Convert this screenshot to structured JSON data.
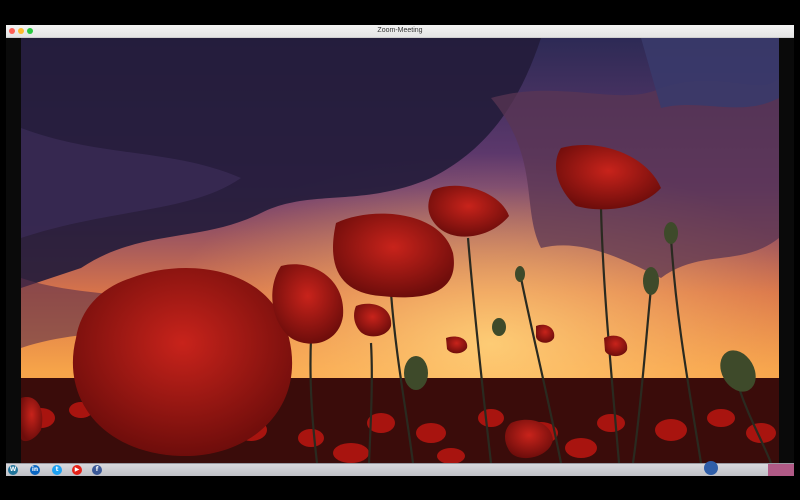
{
  "window": {
    "title": "Zoom-Meeting"
  },
  "video": {
    "description_icon": "shared-screen-video"
  },
  "taskbar": {
    "icons": [
      {
        "name": "wordpress-icon",
        "glyph": "W",
        "color": "#21759b"
      },
      {
        "name": "linkedin-icon",
        "glyph": "in",
        "color": "#0a66c2"
      },
      {
        "name": "twitter-icon",
        "glyph": "t",
        "color": "#1da1f2"
      },
      {
        "name": "youtube-icon",
        "glyph": "▶",
        "color": "#e62117"
      },
      {
        "name": "facebook-icon",
        "glyph": "f",
        "color": "#3b5998"
      }
    ],
    "accent_color": "#b05a86"
  },
  "colors": {
    "close": "#fe5f57",
    "minimize": "#febc2e",
    "maximize": "#28c840"
  }
}
